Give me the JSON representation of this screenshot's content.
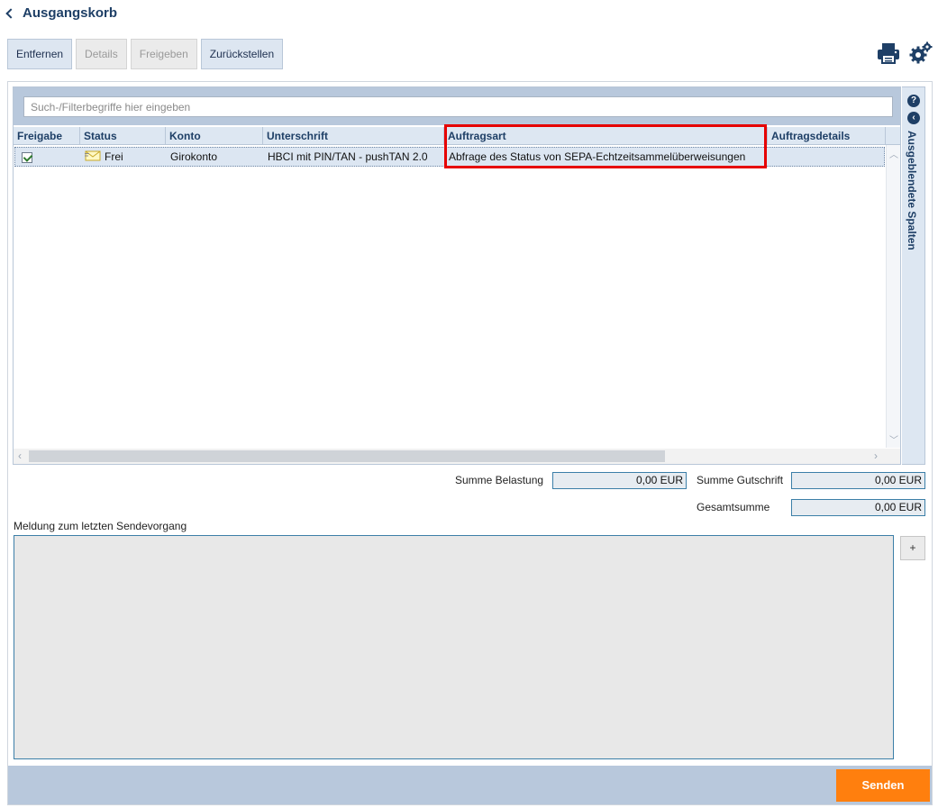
{
  "header": {
    "back_label": "Ausgangskorb"
  },
  "toolbar": {
    "buttons": [
      {
        "label": "Entfernen",
        "enabled": true
      },
      {
        "label": "Details",
        "enabled": false
      },
      {
        "label": "Freigeben",
        "enabled": false
      },
      {
        "label": "Zurückstellen",
        "enabled": true
      }
    ],
    "icons": [
      "printer-icon",
      "gear-icon"
    ]
  },
  "search": {
    "placeholder": "Such-/Filterbegriffe hier eingeben",
    "value": ""
  },
  "table": {
    "columns": [
      "Freigabe",
      "Status",
      "Konto",
      "Unterschrift",
      "Auftragsart",
      "Auftragsdetails"
    ],
    "rows": [
      {
        "freigabe": true,
        "status": "Frei",
        "konto": "Girokonto",
        "unterschrift": "HBCI mit PIN/TAN - pushTAN 2.0",
        "auftragsart": "Abfrage des Status von SEPA-Echtzeitsammelüberweisungen",
        "auftragsdetails": ""
      }
    ],
    "highlight_color": "#e60000"
  },
  "sidebar": {
    "label": "Ausgeblendete Spalten",
    "help_symbol": "?",
    "collapse_symbol": "‹"
  },
  "sums": {
    "belastung_label": "Summe Belastung",
    "belastung_value": "0,00 EUR",
    "gutschrift_label": "Summe Gutschrift",
    "gutschrift_value": "0,00 EUR",
    "gesamt_label": "Gesamtsumme",
    "gesamt_value": "0,00 EUR"
  },
  "message": {
    "label": "Meldung zum letzten Sendevorgang",
    "expand_label": "+"
  },
  "footer": {
    "send_label": "Senden",
    "send_color": "#ff7f0e"
  }
}
